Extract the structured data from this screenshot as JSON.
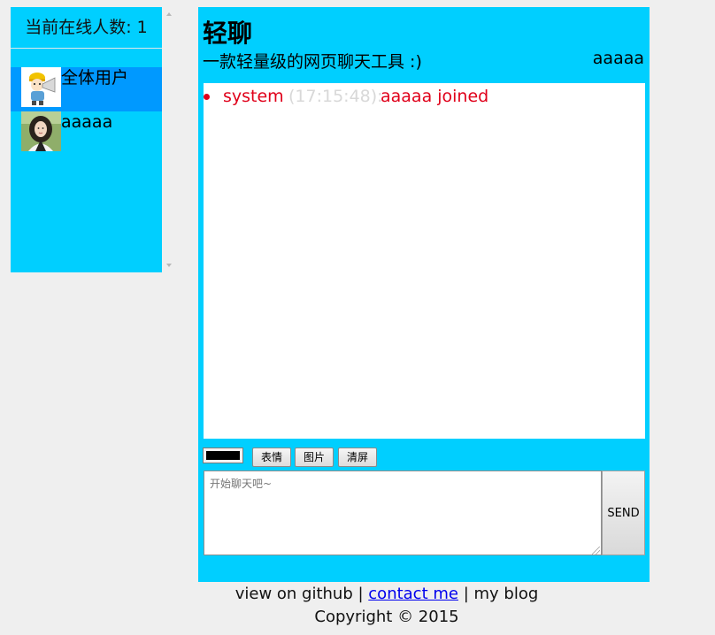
{
  "sidebar": {
    "online_count": "当前在线人数: 1",
    "users": [
      {
        "name": "全体用户",
        "avatar": "megaphone-cartoon-icon",
        "selected": true
      },
      {
        "name": "aaaaa",
        "avatar": "user-photo-avatar",
        "selected": false
      }
    ]
  },
  "header": {
    "title": "轻聊",
    "subtitle": "一款轻量级的网页聊天工具 :)",
    "current_user": "aaaaa"
  },
  "messages": [
    {
      "sender": "system",
      "time": "(17:15:48):",
      "content": "aaaaa joined"
    }
  ],
  "toolbar": {
    "color_value": "#000000",
    "emoji_label": "表情",
    "image_label": "图片",
    "clear_label": "清屏"
  },
  "composer": {
    "placeholder": "开始聊天吧~",
    "send_label": "SEND"
  },
  "footer": {
    "github_text": "view on github",
    "separator1": " | ",
    "contact_text": "contact me",
    "separator2": " | ",
    "blog_text": "my blog",
    "copyright": "Copyright © 2015"
  },
  "colors": {
    "panel_bg": "#00cfff",
    "selected_user_bg": "#0099ff",
    "page_bg": "#efefef",
    "system_text": "#e0001a",
    "time_text": "#d8d8d8"
  }
}
